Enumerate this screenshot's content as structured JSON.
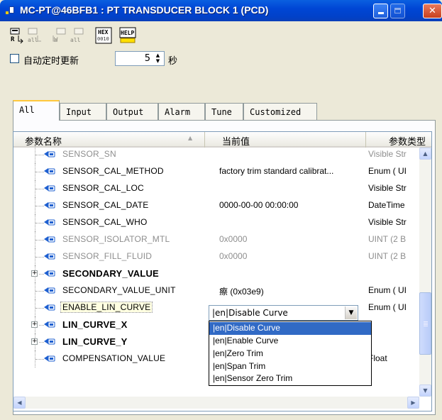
{
  "window": {
    "title": "MC-PT@46BFB1 : PT TRANSDUCER BLOCK 1 (PCD)",
    "minimize_icon": "minimize-icon",
    "maximize_icon": "maximize-icon",
    "close_icon": "close-icon"
  },
  "toolbar": {
    "icons": [
      "read-r-icon",
      "read-all-icon",
      "write-w-icon",
      "write-all-icon",
      "hex-icon",
      "help-icon"
    ],
    "hex_text": "HEX",
    "hex_sub": "0010",
    "help_text": "HELP"
  },
  "auto_update": {
    "checkbox_label": "自动定时更新",
    "checked": false,
    "interval_value": "5",
    "unit": "秒"
  },
  "tabs": [
    "All",
    "Input",
    "Output",
    "Alarm",
    "Tune",
    "Customized"
  ],
  "active_tab": "All",
  "grid": {
    "columns": [
      "参数名称",
      "当前值",
      "参数类型"
    ],
    "rows": [
      {
        "name": "SENSOR_SN",
        "value": "",
        "type": "Visible Str",
        "gray": true,
        "bold": false,
        "expandable": false
      },
      {
        "name": "SENSOR_CAL_METHOD",
        "value": "factory trim standard calibrat...",
        "type": "Enum ( UI",
        "gray": false,
        "bold": false,
        "expandable": false
      },
      {
        "name": "SENSOR_CAL_LOC",
        "value": "",
        "type": "Visible Str",
        "gray": false,
        "bold": false,
        "expandable": false
      },
      {
        "name": "SENSOR_CAL_DATE",
        "value": "0000-00-00 00:00:00",
        "type": "DateTime",
        "gray": false,
        "bold": false,
        "expandable": false
      },
      {
        "name": "SENSOR_CAL_WHO",
        "value": "",
        "type": "Visible Str",
        "gray": false,
        "bold": false,
        "expandable": false
      },
      {
        "name": "SENSOR_ISOLATOR_MTL",
        "value": "0x0000",
        "type": "UINT (2 B",
        "gray": true,
        "bold": false,
        "expandable": false
      },
      {
        "name": "SENSOR_FILL_FLUID",
        "value": "0x0000",
        "type": "UINT (2 B",
        "gray": true,
        "bold": false,
        "expandable": false
      },
      {
        "name": "SECONDARY_VALUE",
        "value": "",
        "type": "",
        "gray": false,
        "bold": true,
        "expandable": true
      },
      {
        "name": "SECONDARY_VALUE_UNIT",
        "value": "瘵      (0x03e9)",
        "type": "Enum ( UI",
        "gray": false,
        "bold": false,
        "expandable": false
      },
      {
        "name": "ENABLE_LIN_CURVE",
        "value": "",
        "type": "Enum ( UI",
        "gray": false,
        "bold": false,
        "expandable": false,
        "selected": true
      },
      {
        "name": "LIN_CURVE_X",
        "value": "",
        "type": "",
        "gray": false,
        "bold": true,
        "expandable": true
      },
      {
        "name": "LIN_CURVE_Y",
        "value": "",
        "type": "",
        "gray": false,
        "bold": true,
        "expandable": true
      },
      {
        "name": "COMPENSATION_VALUE",
        "value": "",
        "type": "Float",
        "gray": false,
        "bold": false,
        "expandable": false
      }
    ]
  },
  "combo": {
    "selected": "|en|Disable Curve",
    "options": [
      "|en|Disable Curve",
      "|en|Enable Curve",
      "|en|Zero Trim",
      "|en|Span Trim",
      "|en|Sensor Zero Trim"
    ],
    "highlighted_index": 0
  },
  "colors": {
    "title_bar": "#0046d5",
    "highlight": "#316ac5",
    "tab_active_accent": "#ffc83c",
    "selected_row": "#ffffe1"
  }
}
